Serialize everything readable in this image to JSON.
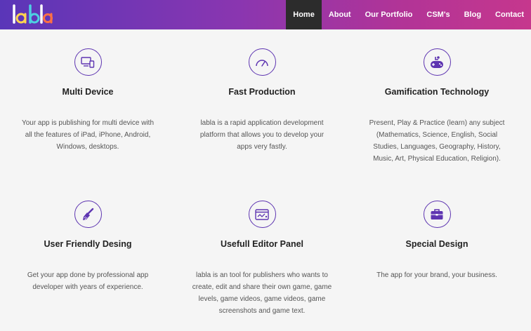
{
  "nav": {
    "items": [
      {
        "label": "Home",
        "active": true
      },
      {
        "label": "About",
        "active": false
      },
      {
        "label": "Our Portfolio",
        "active": false
      },
      {
        "label": "CSM's",
        "active": false
      },
      {
        "label": "Blog",
        "active": false
      },
      {
        "label": "Contact",
        "active": false
      }
    ]
  },
  "colors": {
    "accent": "#5e35b1",
    "nav_gradient_start": "#5a36b8",
    "nav_gradient_end": "#c6378d",
    "active_nav_bg": "#2c2c2c"
  },
  "features": [
    {
      "icon": "devices-icon",
      "title": "Multi Device",
      "desc": "Your app is publishing for multi device with all the features of iPad, iPhone, Android, Windows, desktops."
    },
    {
      "icon": "speedometer-icon",
      "title": "Fast Production",
      "desc": "labla is a rapid application development platform that allows you to develop your apps very fastly."
    },
    {
      "icon": "gamepad-icon",
      "title": "Gamification Technology",
      "desc": "Present, Play & Practice (learn) any subject (Mathematics, Science, English, Social Studies, Languages, Geography, History, Music, Art, Physical Education, Religion)."
    },
    {
      "icon": "brush-icon",
      "title": "User Friendly Desing",
      "desc": "Get your app done by professional app developer with years of experience."
    },
    {
      "icon": "editor-window-icon",
      "title": "Usefull Editor Panel",
      "desc": "labla is an tool for publishers who wants to create, edit and share their own game, game levels, game videos, game videos, game screenshots and game text."
    },
    {
      "icon": "briefcase-icon",
      "title": "Special Design",
      "desc": "The app for your brand, your business."
    }
  ]
}
